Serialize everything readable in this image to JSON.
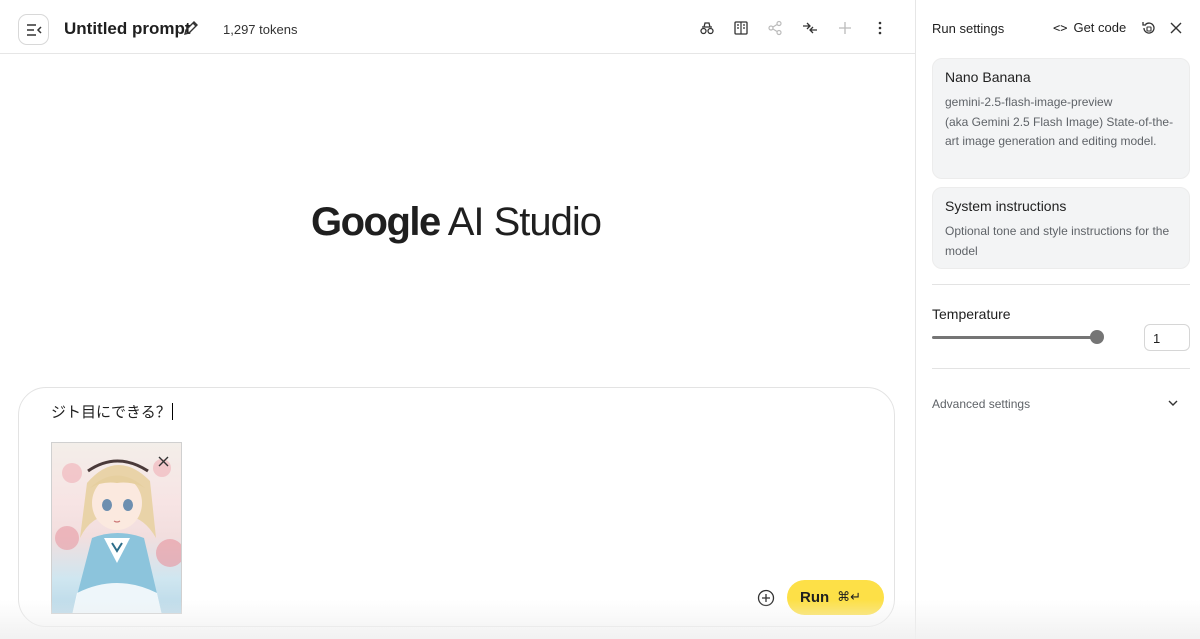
{
  "header": {
    "title": "Untitled prompt",
    "tokens": "1,297 tokens"
  },
  "main": {
    "logo_brand": "Google",
    "logo_product": "AI Studio"
  },
  "prompt": {
    "text": "ジト目にできる？",
    "run_label": "Run",
    "run_shortcut": "⌘↵",
    "attachment_icon": "anime-girl-image-thumbnail"
  },
  "panel": {
    "title": "Run settings",
    "get_code": "Get code",
    "model_card": {
      "name": "Nano Banana",
      "id": "gemini-2.5-flash-image-preview",
      "description": "(aka Gemini 2.5 Flash Image) State-of-the-art image generation and editing model."
    },
    "system_card": {
      "title": "System instructions",
      "description": "Optional tone and style instructions for the model"
    },
    "temperature": {
      "label": "Temperature",
      "value": "1",
      "slider_fraction": 1.0
    },
    "advanced": "Advanced settings"
  },
  "colors": {
    "run_button": "#fde047",
    "card_bg": "#f3f4f5",
    "slider": "#757575"
  }
}
